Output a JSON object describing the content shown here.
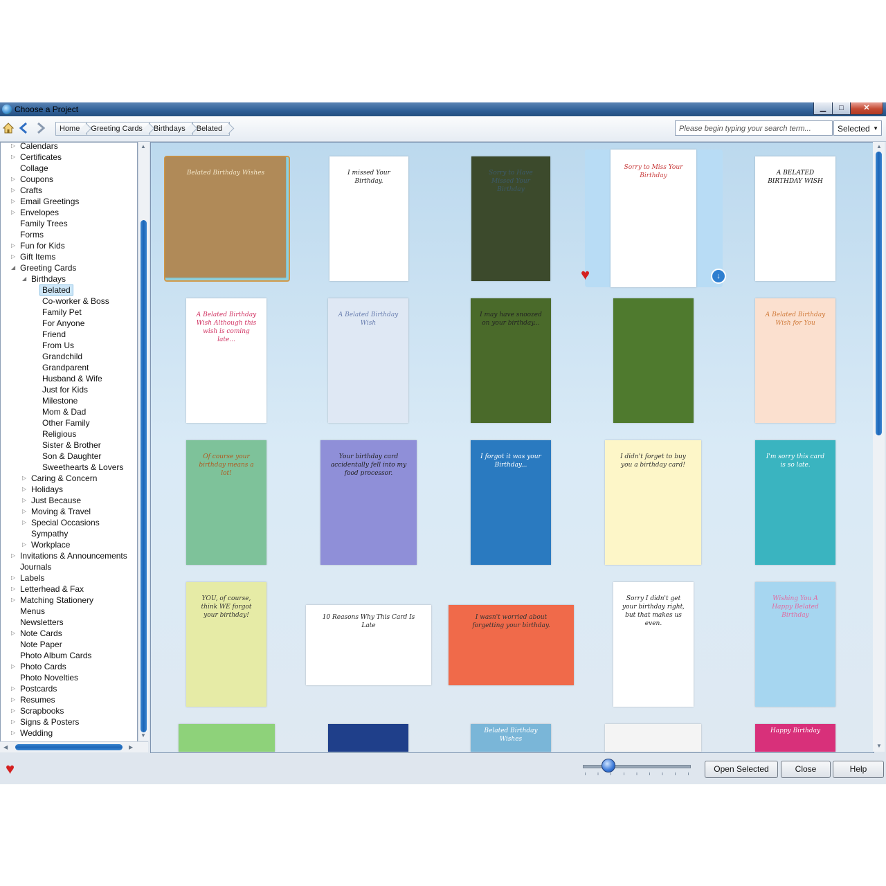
{
  "window": {
    "title": "Choose a Project",
    "min_label": "▁",
    "max_label": "□",
    "close_label": "✕"
  },
  "nav": {
    "breadcrumbs": [
      "Home",
      "Greeting Cards",
      "Birthdays",
      "Belated"
    ],
    "search_placeholder": "Please begin typing your search term...",
    "filter_value": "Selected"
  },
  "tree": {
    "items": [
      {
        "label": "Calendars",
        "level": 0,
        "expander": "▷"
      },
      {
        "label": "Certificates",
        "level": 0,
        "expander": "▷"
      },
      {
        "label": "Collage",
        "level": 0,
        "expander": ""
      },
      {
        "label": "Coupons",
        "level": 0,
        "expander": "▷"
      },
      {
        "label": "Crafts",
        "level": 0,
        "expander": "▷"
      },
      {
        "label": "Email Greetings",
        "level": 0,
        "expander": "▷"
      },
      {
        "label": "Envelopes",
        "level": 0,
        "expander": "▷"
      },
      {
        "label": "Family Trees",
        "level": 0,
        "expander": ""
      },
      {
        "label": "Forms",
        "level": 0,
        "expander": ""
      },
      {
        "label": "Fun for Kids",
        "level": 0,
        "expander": "▷"
      },
      {
        "label": "Gift Items",
        "level": 0,
        "expander": "▷"
      },
      {
        "label": "Greeting Cards",
        "level": 0,
        "expander": "◢"
      },
      {
        "label": "Birthdays",
        "level": 1,
        "expander": "◢"
      },
      {
        "label": "Belated",
        "level": 2,
        "expander": "",
        "selected": true
      },
      {
        "label": "Co-worker & Boss",
        "level": 2,
        "expander": ""
      },
      {
        "label": "Family Pet",
        "level": 2,
        "expander": ""
      },
      {
        "label": "For Anyone",
        "level": 2,
        "expander": ""
      },
      {
        "label": "Friend",
        "level": 2,
        "expander": ""
      },
      {
        "label": "From Us",
        "level": 2,
        "expander": ""
      },
      {
        "label": "Grandchild",
        "level": 2,
        "expander": ""
      },
      {
        "label": "Grandparent",
        "level": 2,
        "expander": ""
      },
      {
        "label": "Husband & Wife",
        "level": 2,
        "expander": ""
      },
      {
        "label": "Just for Kids",
        "level": 2,
        "expander": ""
      },
      {
        "label": "Milestone",
        "level": 2,
        "expander": ""
      },
      {
        "label": "Mom & Dad",
        "level": 2,
        "expander": ""
      },
      {
        "label": "Other Family",
        "level": 2,
        "expander": ""
      },
      {
        "label": "Religious",
        "level": 2,
        "expander": ""
      },
      {
        "label": "Sister & Brother",
        "level": 2,
        "expander": ""
      },
      {
        "label": "Son & Daughter",
        "level": 2,
        "expander": ""
      },
      {
        "label": "Sweethearts & Lovers",
        "level": 2,
        "expander": ""
      },
      {
        "label": "Caring & Concern",
        "level": 1,
        "expander": "▷"
      },
      {
        "label": "Holidays",
        "level": 1,
        "expander": "▷"
      },
      {
        "label": "Just Because",
        "level": 1,
        "expander": "▷"
      },
      {
        "label": "Moving & Travel",
        "level": 1,
        "expander": "▷"
      },
      {
        "label": "Special Occasions",
        "level": 1,
        "expander": "▷"
      },
      {
        "label": "Sympathy",
        "level": 1,
        "expander": ""
      },
      {
        "label": "Workplace",
        "level": 1,
        "expander": "▷"
      },
      {
        "label": "Invitations & Announcements",
        "level": 0,
        "expander": "▷"
      },
      {
        "label": "Journals",
        "level": 0,
        "expander": ""
      },
      {
        "label": "Labels",
        "level": 0,
        "expander": "▷"
      },
      {
        "label": "Letterhead & Fax",
        "level": 0,
        "expander": "▷"
      },
      {
        "label": "Matching Stationery",
        "level": 0,
        "expander": "▷"
      },
      {
        "label": "Menus",
        "level": 0,
        "expander": ""
      },
      {
        "label": "Newsletters",
        "level": 0,
        "expander": ""
      },
      {
        "label": "Note Cards",
        "level": 0,
        "expander": "▷"
      },
      {
        "label": "Note Paper",
        "level": 0,
        "expander": ""
      },
      {
        "label": "Photo Album Cards",
        "level": 0,
        "expander": ""
      },
      {
        "label": "Photo Cards",
        "level": 0,
        "expander": "▷"
      },
      {
        "label": "Photo Novelties",
        "level": 0,
        "expander": ""
      },
      {
        "label": "Postcards",
        "level": 0,
        "expander": "▷"
      },
      {
        "label": "Resumes",
        "level": 0,
        "expander": "▷"
      },
      {
        "label": "Scrapbooks",
        "level": 0,
        "expander": "▷"
      },
      {
        "label": "Signs & Posters",
        "level": 0,
        "expander": "▷"
      },
      {
        "label": "Wedding",
        "level": 0,
        "expander": "▷"
      }
    ]
  },
  "cards": [
    {
      "text": "Belated Birthday Wishes",
      "bg": "#b08a58",
      "fg": "#f3e6c8"
    },
    {
      "text": "I missed Your Birthday.",
      "bg": "#ffffff",
      "fg": "#222222"
    },
    {
      "text": "Sorry to Have Missed Your Birthday",
      "bg": "#3c4a2c",
      "fg": "#3c5a6a"
    },
    {
      "text": "Sorry to Miss Your Birthday",
      "bg": "#ffffff",
      "fg": "#c83a3a"
    },
    {
      "text": "A BELATED BIRTHDAY WISH",
      "bg": "#ffffff",
      "fg": "#111111"
    },
    {
      "text": "A Belated Birthday Wish Although this wish is coming late...",
      "bg": "#ffffff",
      "fg": "#d03060"
    },
    {
      "text": "A Belated Birthday Wish",
      "bg": "#dfe8f4",
      "fg": "#6a7fb0"
    },
    {
      "text": "I may have snoozed on your birthday...",
      "bg": "#4a6a2a",
      "fg": "#222222"
    },
    {
      "text": "",
      "bg": "#4f7a2e",
      "fg": "#ffffff"
    },
    {
      "text": "A Belated Birthday Wish for You",
      "bg": "#fbe0cf",
      "fg": "#d07a3a"
    },
    {
      "text": "Of course your birthday means a lot!",
      "bg": "#7ec29a",
      "fg": "#b05a20"
    },
    {
      "text": "Your birthday card accidentally fell into my food processor.",
      "bg": "#8f8fd8",
      "fg": "#222222"
    },
    {
      "text": "I forgot it was your Birthday...",
      "bg": "#2a7ac0",
      "fg": "#ffffff"
    },
    {
      "text": "I didn't forget to buy you a birthday card!",
      "bg": "#fdf6c8",
      "fg": "#333333"
    },
    {
      "text": "I'm sorry this card is so late.",
      "bg": "#3ab4c0",
      "fg": "#ffffff"
    },
    {
      "text": "YOU, of course, think WE forgot your birthday!",
      "bg": "#e6eba6",
      "fg": "#333333"
    },
    {
      "text": "10 Reasons Why This Card Is Late",
      "bg": "#ffffff",
      "fg": "#222222"
    },
    {
      "text": "I wasn't worried about forgetting your birthday.",
      "bg": "#f06a4a",
      "fg": "#333333"
    },
    {
      "text": "Sorry I didn't get your birthday right, but that makes us even.",
      "bg": "#ffffff",
      "fg": "#222222"
    },
    {
      "text": "Wishing You A Happy Belated Birthday",
      "bg": "#a6d6f0",
      "fg": "#e06aa0"
    },
    {
      "text": "",
      "bg": "#8ed27a",
      "fg": "#ffffff"
    },
    {
      "text": "",
      "bg": "#1f3f8a",
      "fg": "#ffffff"
    },
    {
      "text": "Belated Birthday Wishes",
      "bg": "#7ab6d8",
      "fg": "#ffffff"
    },
    {
      "text": "",
      "bg": "#f4f4f4",
      "fg": "#333333"
    },
    {
      "text": "Happy Birthday",
      "bg": "#d8307a",
      "fg": "#ffffff"
    }
  ],
  "buttons": {
    "open": "Open Selected",
    "close": "Close",
    "help": "Help"
  },
  "zoom_slider": 0.2
}
